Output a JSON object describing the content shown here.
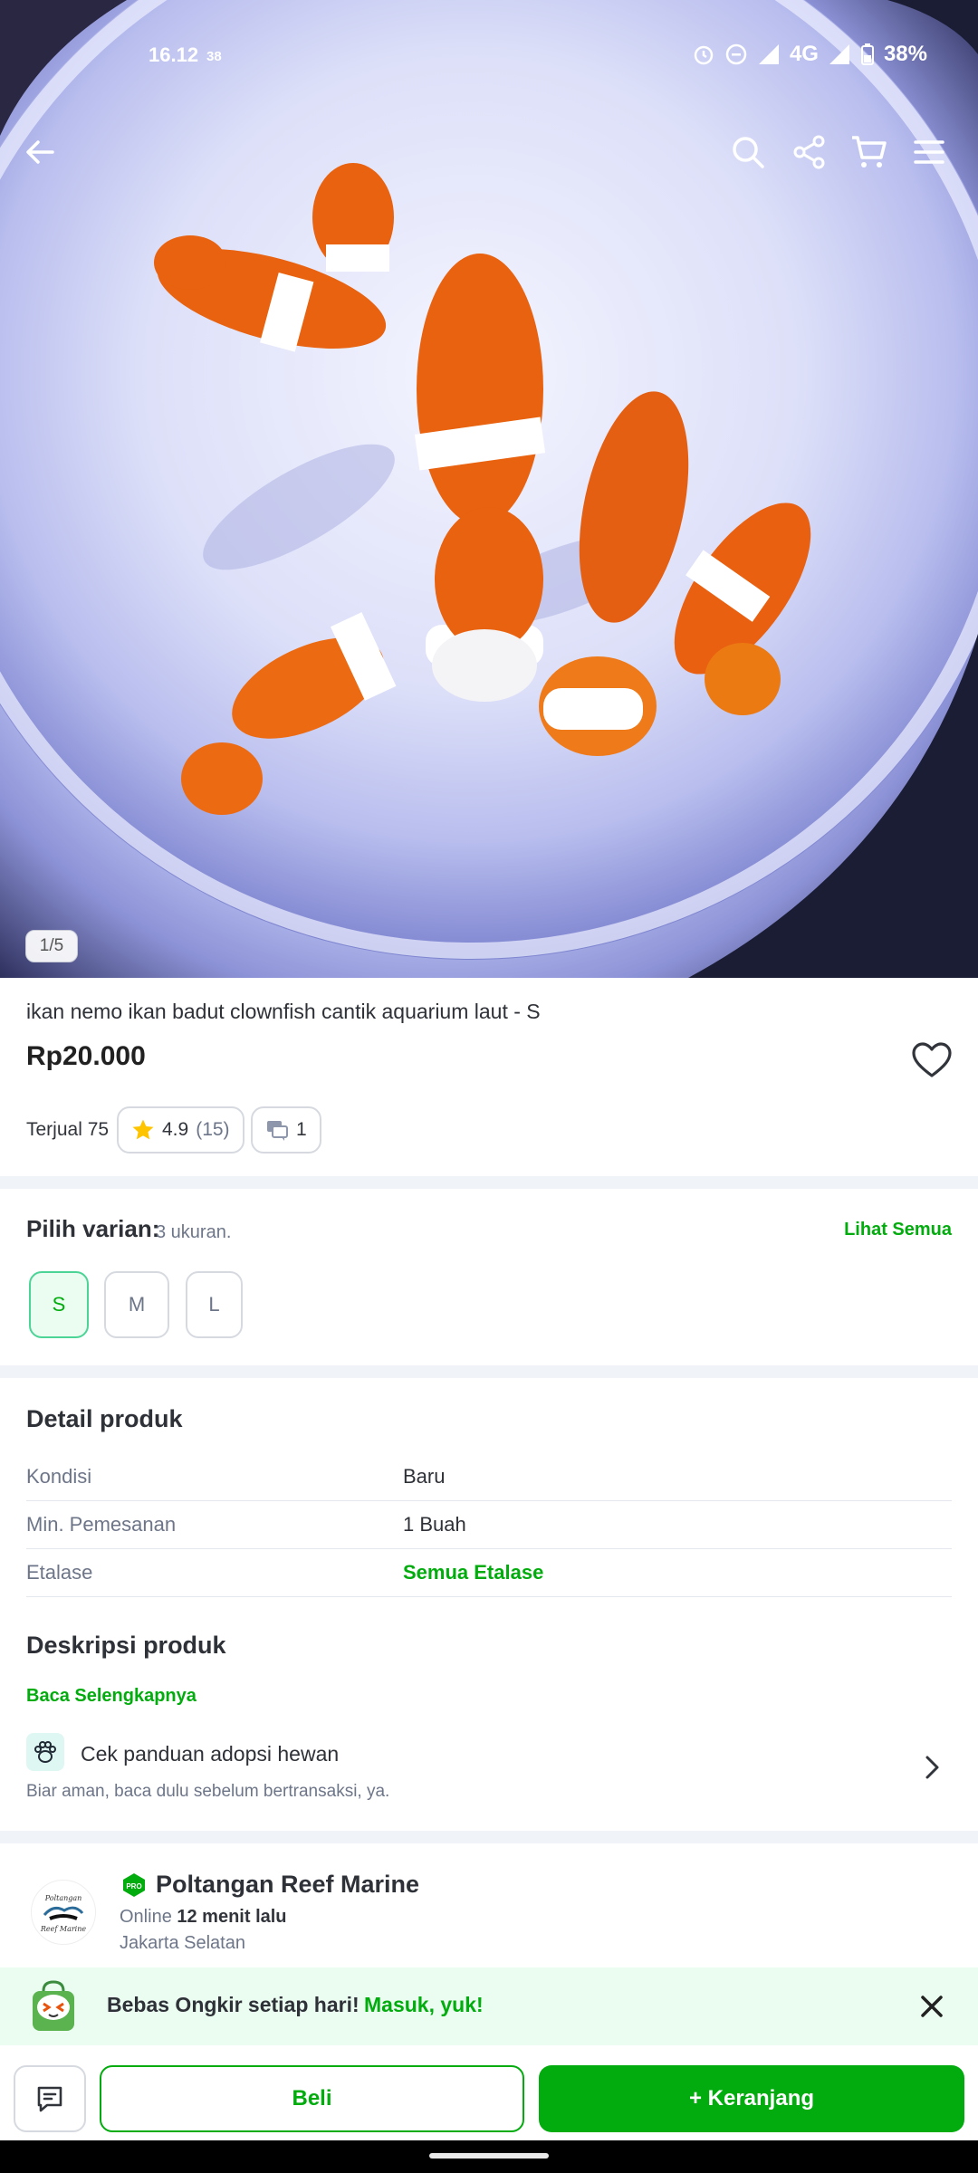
{
  "status_bar": {
    "time": "16.12",
    "sub": "38",
    "network": "4G",
    "battery": "38%"
  },
  "gallery": {
    "counter": "1/5"
  },
  "product": {
    "title": "ikan nemo ikan badut clownfish cantik aquarium laut - S",
    "price": "Rp20.000",
    "sold": "Terjual 75",
    "rating": "4.9",
    "rating_count": "(15)",
    "discussion_count": "1"
  },
  "variant": {
    "label": "Pilih varian:",
    "count": "3 ukuran.",
    "see_all": "Lihat Semua",
    "options": [
      "S",
      "M",
      "L"
    ],
    "selected": "S"
  },
  "detail": {
    "title": "Detail produk",
    "rows": [
      {
        "key": "Kondisi",
        "value": "Baru"
      },
      {
        "key": "Min. Pemesanan",
        "value": "1 Buah"
      },
      {
        "key": "Etalase",
        "value": "Semua Etalase"
      }
    ]
  },
  "description": {
    "title": "Deskripsi produk",
    "read_more": "Baca Selengkapnya",
    "guide_title": "Cek panduan adopsi hewan",
    "guide_sub": "Biar aman, baca dulu sebelum bertransaksi, ya."
  },
  "shop": {
    "badge": "PRO",
    "name": "Poltangan Reef Marine",
    "online_prefix": "Online",
    "online_time": "12 menit lalu",
    "location": "Jakarta Selatan",
    "logo_text_1": "Poltangan",
    "logo_text_2": "Reef Marine"
  },
  "promo": {
    "text": "Bebas Ongkir setiap hari!",
    "link": "Masuk, yuk!"
  },
  "actions": {
    "buy": "Beli",
    "cart": "+ Keranjang"
  },
  "colors": {
    "accent": "#03ac0e",
    "promo_bg": "#ebfdf1",
    "star": "#ffc400"
  }
}
